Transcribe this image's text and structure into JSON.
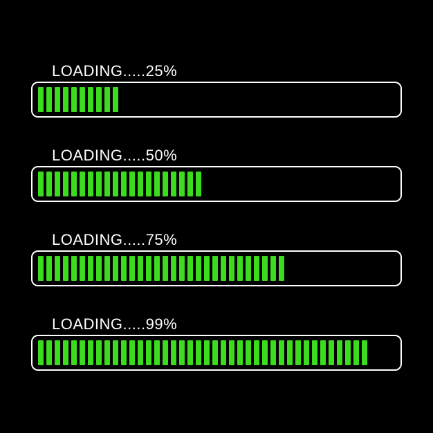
{
  "bars": [
    {
      "label": "LOADING.....",
      "percent_text": "25%",
      "percent": 25
    },
    {
      "label": "LOADING.....",
      "percent_text": "50%",
      "percent": 50
    },
    {
      "label": "LOADING.....",
      "percent_text": "75%",
      "percent": 75
    },
    {
      "label": "LOADING.....",
      "percent_text": "99%",
      "percent": 99
    }
  ],
  "colors": {
    "background": "#000000",
    "bar_fill": "#3bdb1e",
    "bar_border": "#ffffff",
    "text": "#ffffff"
  },
  "segments_total": 40
}
